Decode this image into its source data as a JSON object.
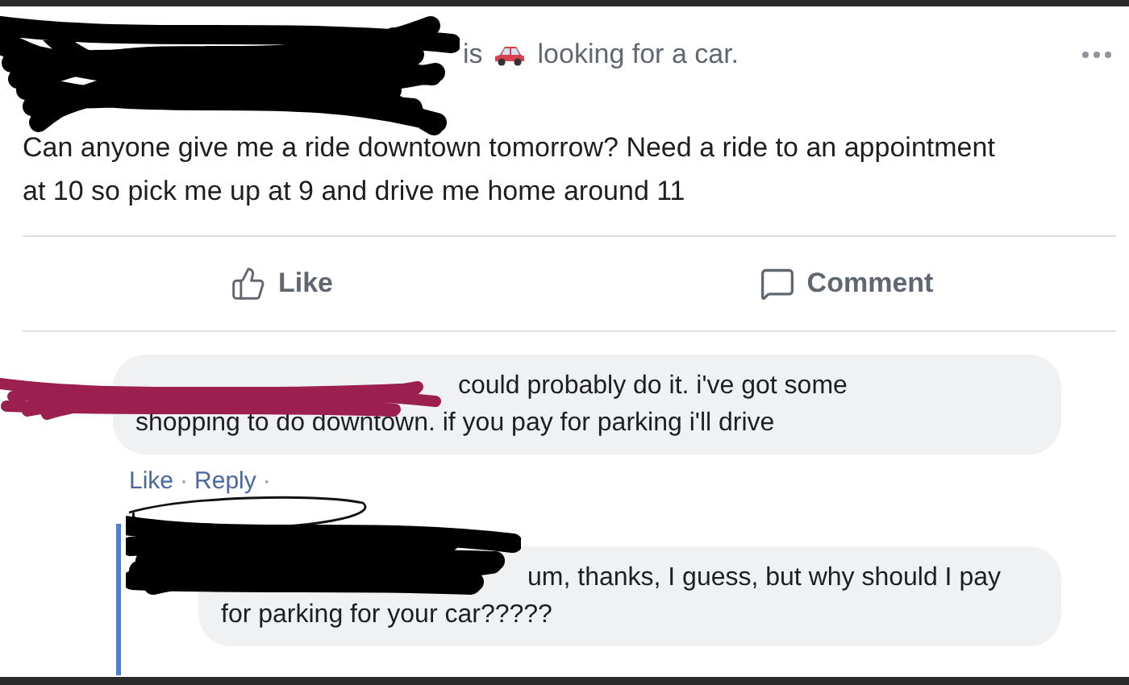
{
  "post": {
    "status_verb": "is",
    "status_text": "looking for a car.",
    "text": "Can anyone give me a ride downtown tomorrow? Need a ride to an appointment at 10 so pick me up at 9 and drive me home around 11"
  },
  "post_actions": [
    {
      "kind": "like",
      "label": "Like"
    },
    {
      "kind": "comment",
      "label": "Comment"
    }
  ],
  "comments": [
    {
      "text": "could probably do it. i've got some shopping to do downtown. if you pay for parking i'll drive",
      "links": [
        "Like",
        "Reply"
      ],
      "separator": "·",
      "replies": [
        {
          "text": "um, thanks, I guess, but why should I pay for parking for your car?????"
        }
      ]
    }
  ]
}
